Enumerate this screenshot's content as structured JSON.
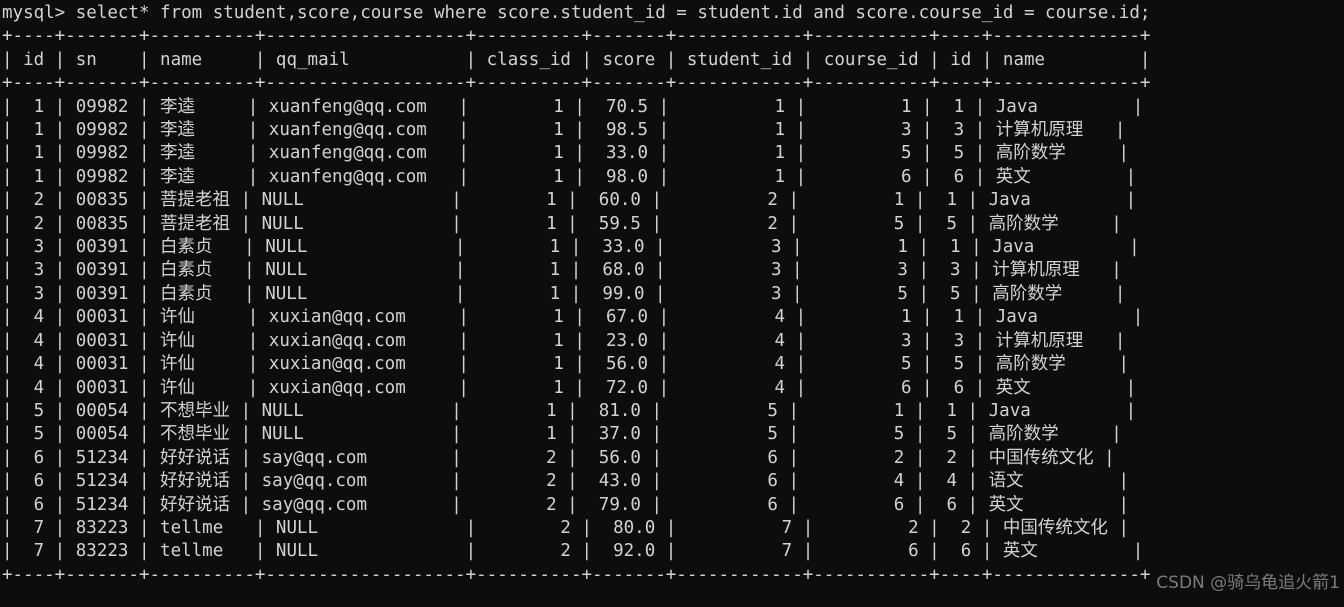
{
  "terminal": {
    "prompt": "mysql> ",
    "query": "select* from student,score,course where score.student_id = student.id and score.course_id = course.id;",
    "background_color": "#0d0d0d",
    "foreground_color": "#d2d2d2",
    "watermark": "CSDN @骑乌龟追火箭1"
  },
  "result_table": {
    "columns": [
      {
        "name": "id",
        "width": 2,
        "align": "right"
      },
      {
        "name": "sn",
        "width": 5,
        "align": "left"
      },
      {
        "name": "name",
        "width": 8,
        "align": "left"
      },
      {
        "name": "qq_mail",
        "width": 17,
        "align": "left"
      },
      {
        "name": "class_id",
        "width": 8,
        "align": "right"
      },
      {
        "name": "score",
        "width": 5,
        "align": "right"
      },
      {
        "name": "student_id",
        "width": 10,
        "align": "right"
      },
      {
        "name": "course_id",
        "width": 9,
        "align": "right"
      },
      {
        "name": "id",
        "width": 2,
        "align": "right"
      },
      {
        "name": "name",
        "width": 12,
        "align": "left"
      }
    ],
    "rows": [
      [
        "1",
        "09982",
        "李逵",
        "xuanfeng@qq.com",
        "1",
        "70.5",
        "1",
        "1",
        "1",
        "Java"
      ],
      [
        "1",
        "09982",
        "李逵",
        "xuanfeng@qq.com",
        "1",
        "98.5",
        "1",
        "3",
        "3",
        "计算机原理"
      ],
      [
        "1",
        "09982",
        "李逵",
        "xuanfeng@qq.com",
        "1",
        "33.0",
        "1",
        "5",
        "5",
        "高阶数学"
      ],
      [
        "1",
        "09982",
        "李逵",
        "xuanfeng@qq.com",
        "1",
        "98.0",
        "1",
        "6",
        "6",
        "英文"
      ],
      [
        "2",
        "00835",
        "菩提老祖",
        "NULL",
        "1",
        "60.0",
        "2",
        "1",
        "1",
        "Java"
      ],
      [
        "2",
        "00835",
        "菩提老祖",
        "NULL",
        "1",
        "59.5",
        "2",
        "5",
        "5",
        "高阶数学"
      ],
      [
        "3",
        "00391",
        "白素贞",
        "NULL",
        "1",
        "33.0",
        "3",
        "1",
        "1",
        "Java"
      ],
      [
        "3",
        "00391",
        "白素贞",
        "NULL",
        "1",
        "68.0",
        "3",
        "3",
        "3",
        "计算机原理"
      ],
      [
        "3",
        "00391",
        "白素贞",
        "NULL",
        "1",
        "99.0",
        "3",
        "5",
        "5",
        "高阶数学"
      ],
      [
        "4",
        "00031",
        "许仙",
        "xuxian@qq.com",
        "1",
        "67.0",
        "4",
        "1",
        "1",
        "Java"
      ],
      [
        "4",
        "00031",
        "许仙",
        "xuxian@qq.com",
        "1",
        "23.0",
        "4",
        "3",
        "3",
        "计算机原理"
      ],
      [
        "4",
        "00031",
        "许仙",
        "xuxian@qq.com",
        "1",
        "56.0",
        "4",
        "5",
        "5",
        "高阶数学"
      ],
      [
        "4",
        "00031",
        "许仙",
        "xuxian@qq.com",
        "1",
        "72.0",
        "4",
        "6",
        "6",
        "英文"
      ],
      [
        "5",
        "00054",
        "不想毕业",
        "NULL",
        "1",
        "81.0",
        "5",
        "1",
        "1",
        "Java"
      ],
      [
        "5",
        "00054",
        "不想毕业",
        "NULL",
        "1",
        "37.0",
        "5",
        "5",
        "5",
        "高阶数学"
      ],
      [
        "6",
        "51234",
        "好好说话",
        "say@qq.com",
        "2",
        "56.0",
        "6",
        "2",
        "2",
        "中国传统文化"
      ],
      [
        "6",
        "51234",
        "好好说话",
        "say@qq.com",
        "2",
        "43.0",
        "6",
        "4",
        "4",
        "语文"
      ],
      [
        "6",
        "51234",
        "好好说话",
        "say@qq.com",
        "2",
        "79.0",
        "6",
        "6",
        "6",
        "英文"
      ],
      [
        "7",
        "83223",
        "tellme",
        "NULL",
        "2",
        "80.0",
        "7",
        "2",
        "2",
        "中国传统文化"
      ],
      [
        "7",
        "83223",
        "tellme",
        "NULL",
        "2",
        "92.0",
        "7",
        "6",
        "6",
        "英文"
      ]
    ]
  }
}
